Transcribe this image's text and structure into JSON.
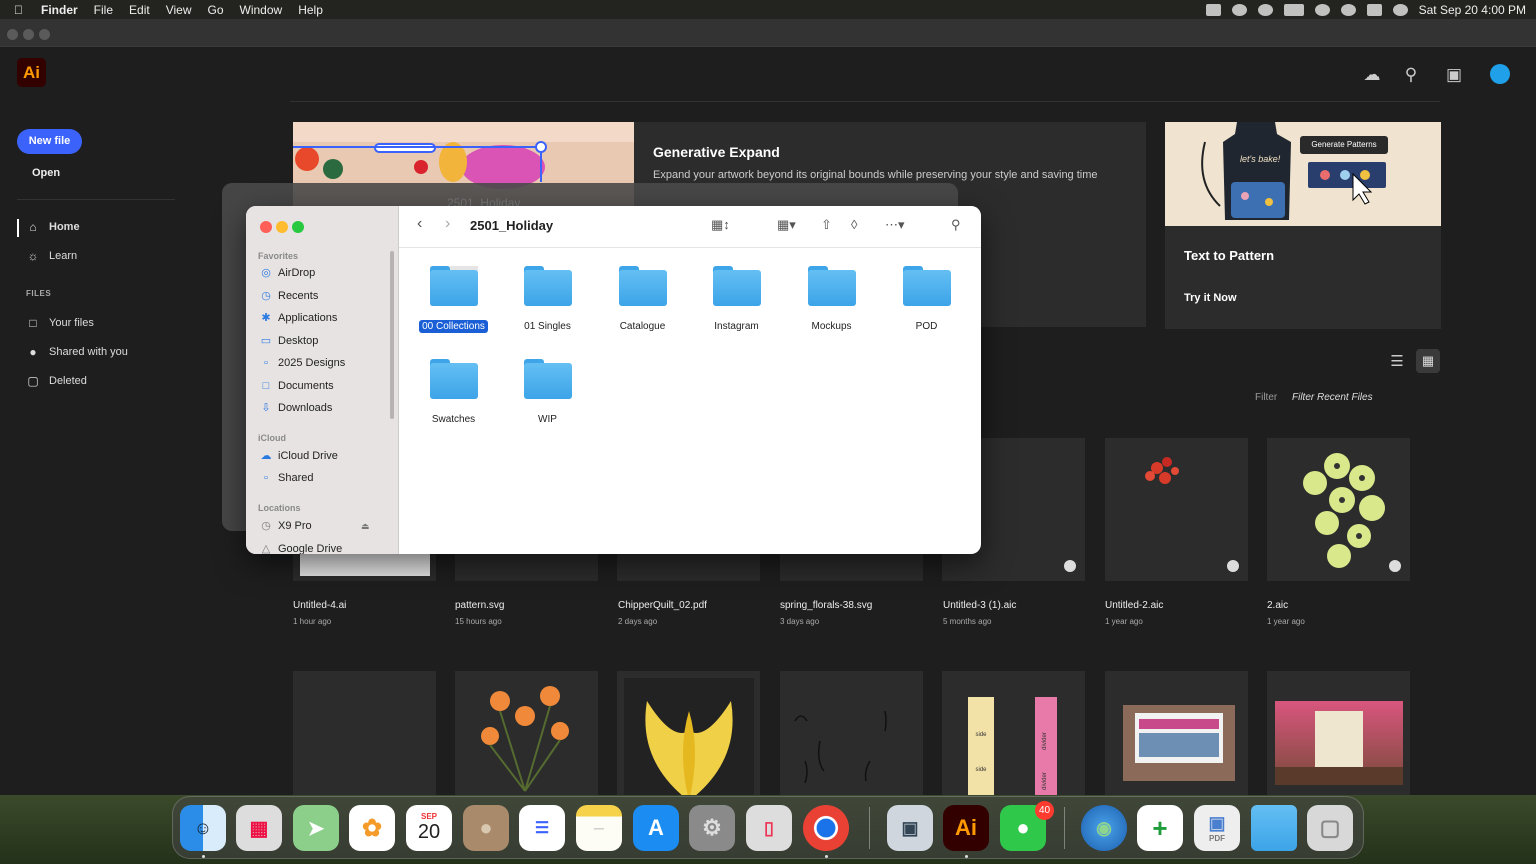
{
  "menubar": {
    "apple_icon": "apple-icon",
    "items": [
      "Finder",
      "File",
      "Edit",
      "View",
      "Go",
      "Window",
      "Help"
    ],
    "datetime": "Sat Sep 20  4:00 PM"
  },
  "illustrator": {
    "logo": "Ai",
    "header_icons": [
      "cloud-icon",
      "search-icon",
      "gift-icon",
      "avatar"
    ],
    "new_file": "New file",
    "open": "Open",
    "nav": [
      {
        "label": "Home",
        "icon": "home-icon"
      },
      {
        "label": "Learn",
        "icon": "lightbulb-icon"
      }
    ],
    "files_header": "FILES",
    "files_nav": [
      {
        "label": "Your files",
        "icon": "file-icon"
      },
      {
        "label": "Shared with you",
        "icon": "people-icon"
      },
      {
        "label": "Deleted",
        "icon": "trash-icon"
      }
    ],
    "gen_expand": {
      "title": "Generative Expand",
      "desc": "Expand your artwork beyond its original bounds while preserving your style and saving time"
    },
    "text_to_pattern": {
      "title": "Text to Pattern",
      "link": "Try it Now",
      "button": "Generate Patterns",
      "apron_text": "let's bake!"
    },
    "filter_label": "Filter",
    "filter_placeholder": "Filter Recent Files",
    "recent_files": [
      {
        "name": "Untitled-4.ai",
        "time": "1 hour ago"
      },
      {
        "name": "pattern.svg",
        "time": "15 hours ago"
      },
      {
        "name": "ChipperQuilt_02.pdf",
        "time": "2 days ago"
      },
      {
        "name": "spring_florals-38.svg",
        "time": "3 days ago"
      },
      {
        "name": "Untitled-3 (1).aic",
        "time": "5 months ago"
      },
      {
        "name": "Untitled-2.aic",
        "time": "1 year ago"
      },
      {
        "name": "2.aic",
        "time": "1 year ago"
      }
    ],
    "thumb_labels": {
      "side": "side",
      "divider": "divider",
      "top": "top"
    }
  },
  "finder_back": {
    "title": "2501_Holiday"
  },
  "finder": {
    "title": "2501_Holiday",
    "sections": {
      "favorites": "Favorites",
      "icloud": "iCloud",
      "locations": "Locations"
    },
    "favorites": [
      {
        "label": "AirDrop",
        "icon": "airdrop-icon"
      },
      {
        "label": "Recents",
        "icon": "clock-icon"
      },
      {
        "label": "Applications",
        "icon": "applications-icon"
      },
      {
        "label": "Desktop",
        "icon": "desktop-icon"
      },
      {
        "label": "2025 Designs",
        "icon": "folder-icon"
      },
      {
        "label": "Documents",
        "icon": "document-icon"
      },
      {
        "label": "Downloads",
        "icon": "download-icon"
      }
    ],
    "icloud": [
      {
        "label": "iCloud Drive",
        "icon": "cloud-icon"
      },
      {
        "label": "Shared",
        "icon": "shared-folder-icon"
      }
    ],
    "locations": [
      {
        "label": "X9 Pro",
        "icon": "disk-icon"
      },
      {
        "label": "Google Drive",
        "icon": "drive-icon"
      }
    ],
    "folders": [
      "00 Collections",
      "01 Singles",
      "Catalogue",
      "Instagram",
      "Mockups",
      "POD",
      "Swatches",
      "WIP"
    ],
    "selected": "00 Collections"
  },
  "dock": {
    "calendar_month": "SEP",
    "calendar_day": "20",
    "illustrator_label": "Ai",
    "messages_badge": "40",
    "pdf_label": "PDF",
    "apps": [
      "Finder",
      "Launchpad",
      "Maps",
      "Photos",
      "Calendar",
      "Contacts",
      "Reminders",
      "Notes",
      "App Store",
      "System Settings",
      "iPhone Mirroring",
      "Chrome",
      "Preview",
      "Illustrator",
      "Messages",
      "Globe",
      "Numbers",
      "PDF",
      "Folder",
      "Trash"
    ]
  }
}
